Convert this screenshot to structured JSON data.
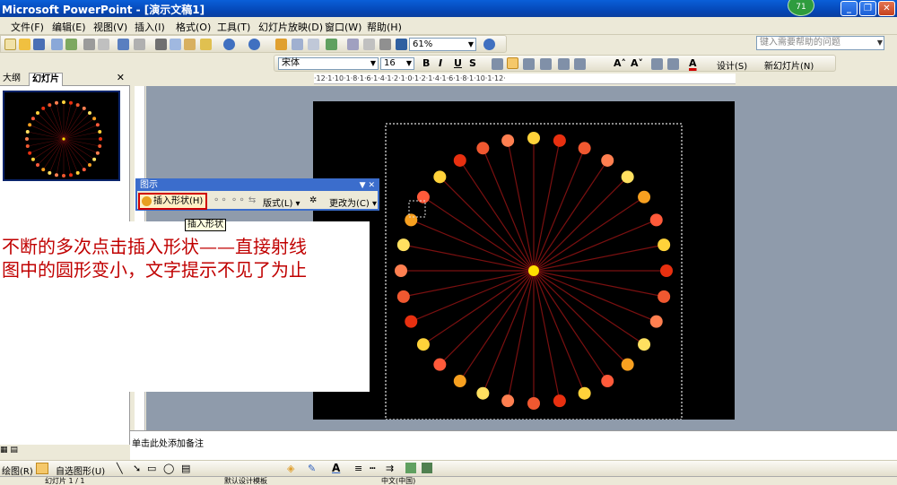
{
  "window": {
    "title": "Microsoft PowerPoint - [演示文稿1]",
    "badge": "71"
  },
  "menu": [
    "文件(F)",
    "编辑(E)",
    "视图(V)",
    "插入(I)",
    "格式(O)",
    "工具(T)",
    "幻灯片放映(D)",
    "窗口(W)",
    "帮助(H)"
  ],
  "help_placeholder": "键入需要帮助的问题",
  "toolbar": {
    "zoom": "61%",
    "font_name": "宋体",
    "font_size": "16",
    "bold": "B",
    "italic": "I",
    "underline": "U",
    "shadow": "S",
    "font_color": "A",
    "design_label": "设计(S)",
    "new_slide_label": "新幻灯片(N)"
  },
  "ruler": "·12·1·10·1·8·1·6·1·4·1·2·1·0·1·2·1·4·1·6·1·8·1·10·1·12·",
  "left_pane": {
    "tab_outline": "大纲",
    "tab_slides": "幻灯片",
    "close": "✕"
  },
  "diagram_toolbar": {
    "title": "图示",
    "insert_shape": "插入形状(H)",
    "layout": "版式(L)",
    "change_to": "更改为(C)"
  },
  "tooltip": "插入形状",
  "annotation": {
    "line1": "不断的多次点击插入形状——直接射线",
    "line2": "图中的圆形变小，文字提示不见了为止"
  },
  "notes_placeholder": "单击此处添加备注",
  "draw_toolbar": {
    "autoshapes": "自选图形(U)",
    "draw_label": "绘图(R)"
  },
  "status": {
    "slide": "幻灯片 1 / 1",
    "design": "默认设计模板",
    "language": "中文(中国)"
  },
  "colors": {
    "title_bar": "#0548b8",
    "annotation_red": "#c00000",
    "highlight_border": "#d00000",
    "dot_colors": [
      "#ffd23a",
      "#f7a020",
      "#ff7f50",
      "#e83010",
      "#ff5a3a",
      "#ffe060",
      "#f05830"
    ]
  }
}
